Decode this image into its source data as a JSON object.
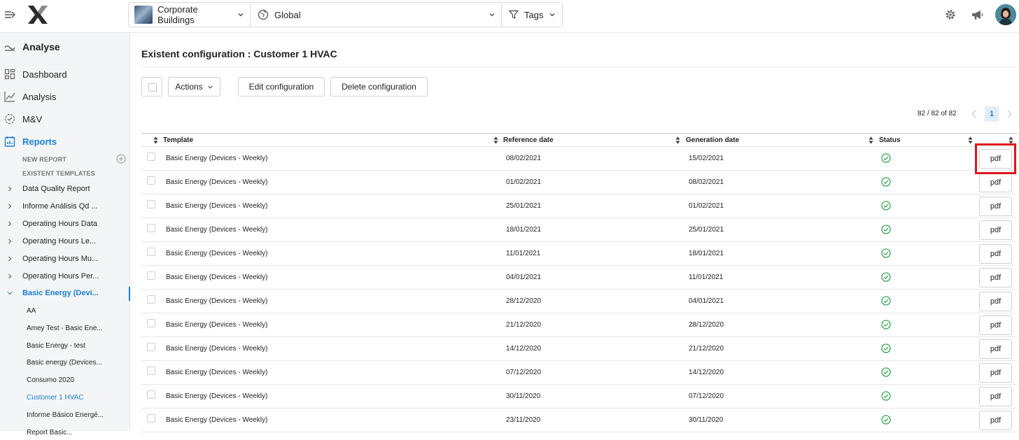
{
  "topbar": {
    "building_label": "Corporate Buildings",
    "scope_label": "Global",
    "tags_label": "Tags"
  },
  "sidebar": {
    "section": "Analyse",
    "nav": [
      {
        "label": "Dashboard",
        "icon": "dashboard-icon"
      },
      {
        "label": "Analysis",
        "icon": "analysis-chart-icon"
      },
      {
        "label": "M&V",
        "icon": "check-circle-dashed-icon"
      },
      {
        "label": "Reports",
        "icon": "reports-icon",
        "active": true
      }
    ],
    "new_report": "NEW REPORT",
    "existent_templates": "EXISTENT TEMPLATES",
    "templates": [
      "Data Quality Report",
      "Informe Análisis Qd ...",
      "Operating Hours Data",
      "Operating Hours Le...",
      "Operating Hours Mu...",
      "Operating Hours Per...",
      "Basic Energy (Devi..."
    ],
    "configurations": [
      "AA",
      "Amey Test - Basic Ene...",
      "Basic Energy - test",
      "Basic energy (Devices...",
      "Consumo 2020",
      "Customer 1 HVAC",
      "Informe Básico Energé...",
      "Report Basic..."
    ]
  },
  "main": {
    "title": "Existent configuration : Customer 1 HVAC",
    "actions_label": "Actions",
    "edit_label": "Edit configuration",
    "delete_label": "Delete configuration",
    "pagination": {
      "info": "82 / 82 of 82",
      "page": "1"
    },
    "columns": [
      "Template",
      "Reference date",
      "Generation date",
      "Status"
    ],
    "rows": [
      {
        "template": "Basic Energy (Devices - Weekly)",
        "reference": "08/02/2021",
        "generation": "15/02/2021",
        "action": "pdf"
      },
      {
        "template": "Basic Energy (Devices - Weekly)",
        "reference": "01/02/2021",
        "generation": "08/02/2021",
        "action": "pdf"
      },
      {
        "template": "Basic Energy (Devices - Weekly)",
        "reference": "25/01/2021",
        "generation": "01/02/2021",
        "action": "pdf"
      },
      {
        "template": "Basic Energy (Devices - Weekly)",
        "reference": "18/01/2021",
        "generation": "25/01/2021",
        "action": "pdf"
      },
      {
        "template": "Basic Energy (Devices - Weekly)",
        "reference": "11/01/2021",
        "generation": "18/01/2021",
        "action": "pdf"
      },
      {
        "template": "Basic Energy (Devices - Weekly)",
        "reference": "04/01/2021",
        "generation": "11/01/2021",
        "action": "pdf"
      },
      {
        "template": "Basic Energy (Devices - Weekly)",
        "reference": "28/12/2020",
        "generation": "04/01/2021",
        "action": "pdf"
      },
      {
        "template": "Basic Energy (Devices - Weekly)",
        "reference": "21/12/2020",
        "generation": "28/12/2020",
        "action": "pdf"
      },
      {
        "template": "Basic Energy (Devices - Weekly)",
        "reference": "14/12/2020",
        "generation": "21/12/2020",
        "action": "pdf"
      },
      {
        "template": "Basic Energy (Devices - Weekly)",
        "reference": "07/12/2020",
        "generation": "14/12/2020",
        "action": "pdf"
      },
      {
        "template": "Basic Energy (Devices - Weekly)",
        "reference": "30/11/2020",
        "generation": "07/12/2020",
        "action": "pdf"
      },
      {
        "template": "Basic Energy (Devices - Weekly)",
        "reference": "23/11/2020",
        "generation": "30/11/2020",
        "action": "pdf"
      }
    ]
  },
  "colors": {
    "accent": "#1a7fd4",
    "status_ok": "#3aa757",
    "highlight": "#e0141e"
  }
}
